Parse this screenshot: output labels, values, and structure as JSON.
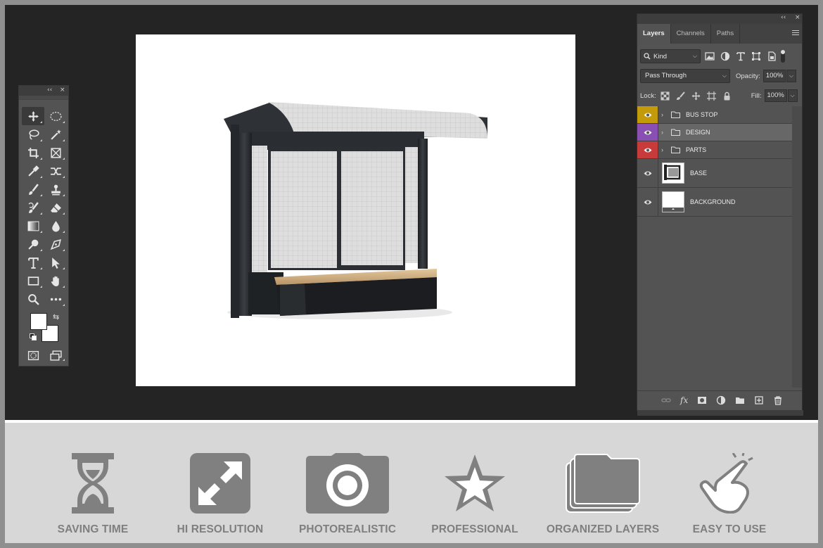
{
  "tools_panel": {
    "collapse_icon": "double-chevron-left-icon",
    "close_icon": "close-icon",
    "collapse_text": "‹‹",
    "close_text": "×"
  },
  "layers_panel": {
    "collapse_text": "‹‹",
    "close_text": "×",
    "tabs": [
      "Layers",
      "Channels",
      "Paths"
    ],
    "filter_kind": "Kind",
    "blend_mode": "Pass Through",
    "opacity_label": "Opacity:",
    "opacity_value": "100%",
    "lock_label": "Lock:",
    "fill_label": "Fill:",
    "fill_value": "100%",
    "layers": [
      {
        "name": "BUS STOP",
        "type": "group",
        "color": "#c39a0a"
      },
      {
        "name": "DESIGN",
        "type": "group",
        "color": "#8a4fb3"
      },
      {
        "name": "PARTS",
        "type": "group",
        "color": "#c83b3b"
      },
      {
        "name": "BASE",
        "type": "layer",
        "color": ""
      },
      {
        "name": "BACKGROUND",
        "type": "layer",
        "color": ""
      }
    ]
  },
  "features": [
    {
      "label": "SAVING TIME",
      "icon": "hourglass-icon"
    },
    {
      "label": "HI RESOLUTION",
      "icon": "expand-arrows-icon"
    },
    {
      "label": "PHOTOREALISTIC",
      "icon": "camera-icon"
    },
    {
      "label": "PROFESSIONAL",
      "icon": "star-icon"
    },
    {
      "label": "ORGANIZED LAYERS",
      "icon": "stacked-folders-icon"
    },
    {
      "label": "EASY TO USE",
      "icon": "pointing-hand-icon"
    }
  ],
  "colors": {
    "workspace": "#242424",
    "panel": "#535353",
    "feature_text": "#7f7f7f",
    "feature_icon": "#808080"
  }
}
